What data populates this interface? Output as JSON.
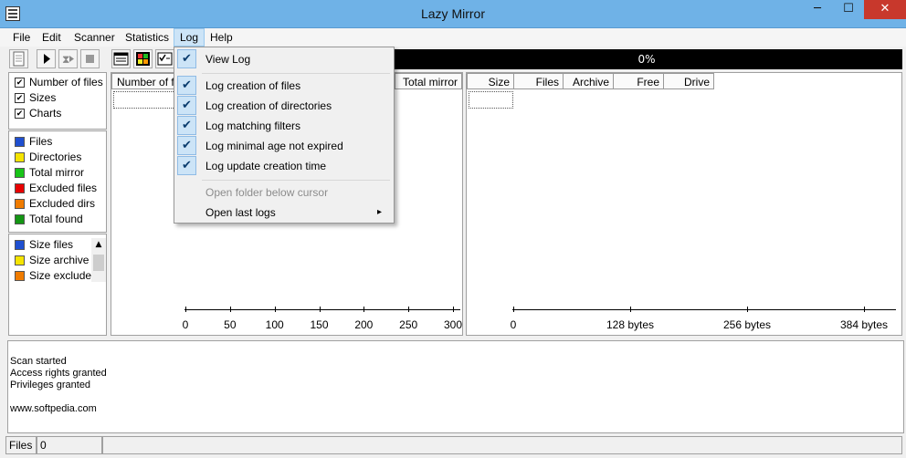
{
  "window": {
    "title": "Lazy Mirror",
    "minimize": "─",
    "maximize": "☐",
    "close": "✕"
  },
  "menu": [
    "File",
    "Edit",
    "Scanner",
    "Statistics",
    "Log",
    "Help"
  ],
  "progress": "0%",
  "options": {
    "items": [
      {
        "label": "Number of files",
        "checked": true
      },
      {
        "label": "Sizes",
        "checked": true
      },
      {
        "label": "Charts",
        "checked": true
      }
    ]
  },
  "legend": {
    "items": [
      {
        "label": "Files",
        "color": "#1f4fd0"
      },
      {
        "label": "Directories",
        "color": "#f5e400"
      },
      {
        "label": "Total mirror",
        "color": "#18c418"
      },
      {
        "label": "Excluded files",
        "color": "#e80000"
      },
      {
        "label": "Excluded dirs",
        "color": "#f07c00"
      },
      {
        "label": "Total found",
        "color": "#149614"
      }
    ]
  },
  "size_legend": {
    "items": [
      {
        "label": "Size files",
        "color": "#1f4fd0"
      },
      {
        "label": "Size archive",
        "color": "#f5e400"
      },
      {
        "label": "Size excluded",
        "color": "#f07c00"
      }
    ]
  },
  "left_grid": {
    "col1": "Number of files",
    "col2": "Total mirror",
    "axis": [
      "0",
      "50",
      "100",
      "150",
      "200",
      "250",
      "300"
    ]
  },
  "right_grid": {
    "columns": [
      "Size",
      "Files",
      "Archive",
      "Free",
      "Drive"
    ],
    "axis": [
      "0",
      "128 bytes",
      "256 bytes",
      "384 bytes"
    ]
  },
  "log": [
    "Scan started",
    "Access rights granted",
    "Privileges granted",
    "",
    "www.softpedia.com"
  ],
  "status": {
    "label": "Files",
    "value": "0"
  },
  "log_menu": {
    "view_log": "View Log",
    "items": [
      {
        "label": "Log creation of files",
        "checked": true
      },
      {
        "label": "Log creation of directories",
        "checked": true
      },
      {
        "label": "Log matching filters",
        "checked": true
      },
      {
        "label": "Log minimal age not expired",
        "checked": true
      },
      {
        "label": "Log update creation time",
        "checked": true
      }
    ],
    "open_folder": "Open folder below cursor",
    "open_last": "Open last logs",
    "submenu_arrow": "▸"
  },
  "colors": {
    "titlebar": "#6fb2e7",
    "close": "#c8382c",
    "menu_highlight": "#cce4f7"
  }
}
